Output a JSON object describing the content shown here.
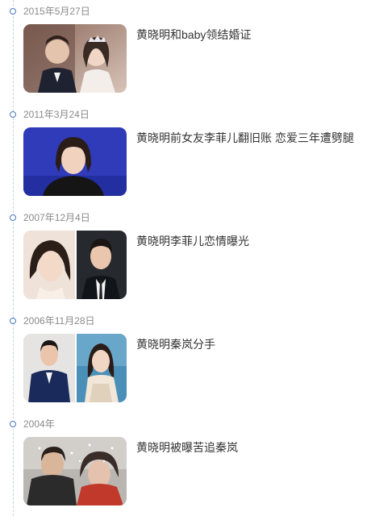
{
  "timeline": {
    "entries": [
      {
        "date": "2015年5月27日",
        "title": "黄晓明和baby领结婚证"
      },
      {
        "date": "2011年3月24日",
        "title": "黄晓明前女友李菲儿翻旧账 恋爱三年遭劈腿"
      },
      {
        "date": "2007年12月4日",
        "title": "黄晓明李菲儿恋情曝光"
      },
      {
        "date": "2006年11月28日",
        "title": "黄晓明秦岚分手"
      },
      {
        "date": "2004年",
        "title": "黄晓明被曝苦追秦岚"
      }
    ]
  },
  "colors": {
    "dot_border": "#4a78c2",
    "line": "#c9d2e6",
    "date_text": "#8a8a8a",
    "title_text": "#333333"
  }
}
